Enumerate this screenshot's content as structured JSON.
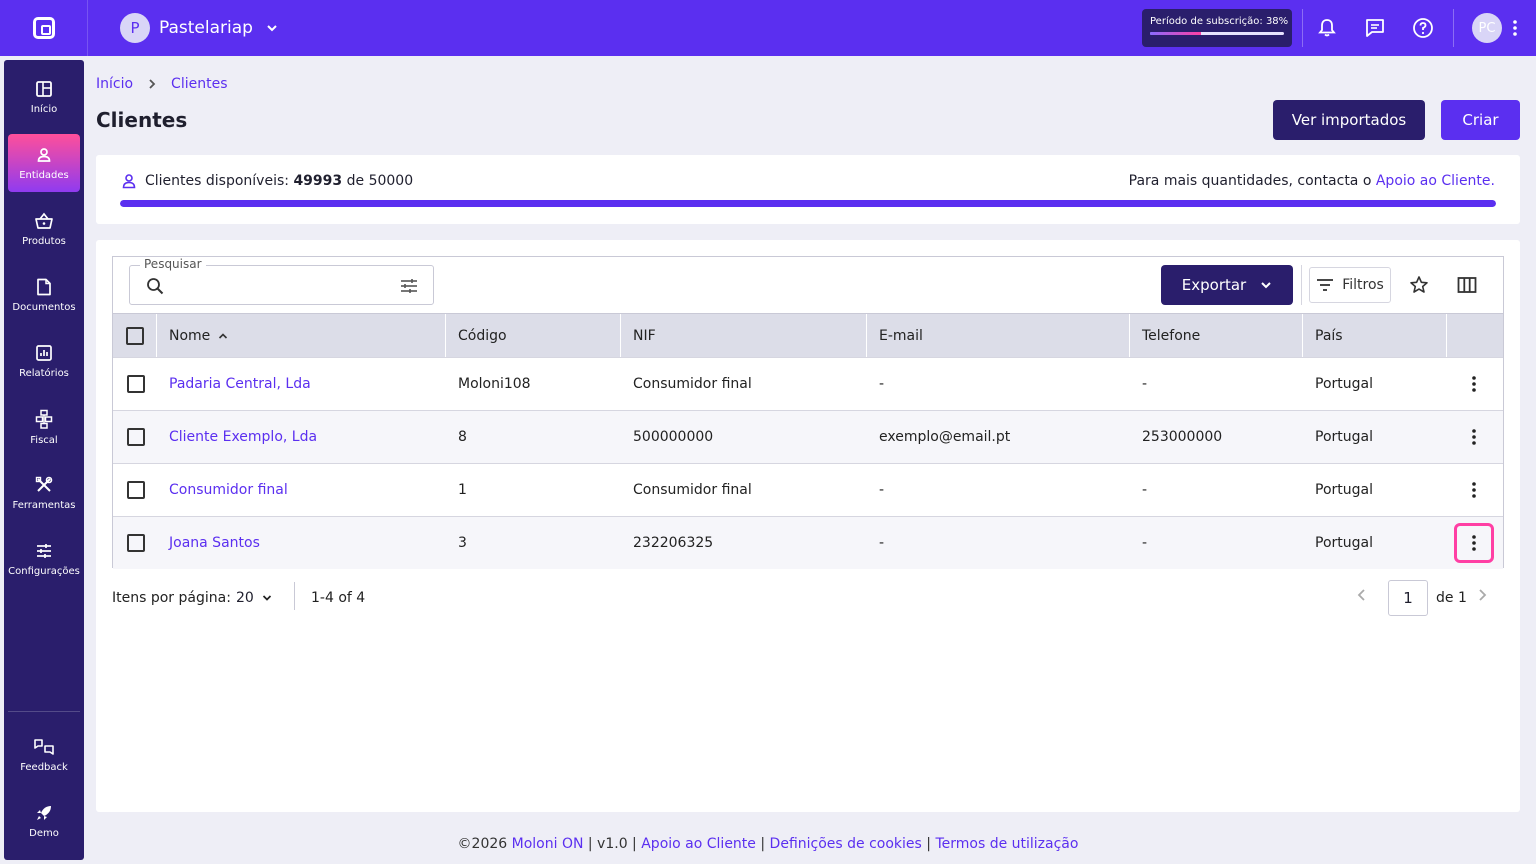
{
  "colors": {
    "primary": "#5b2ff0",
    "dark": "#2a1e6c",
    "accent_pink": "#ff3fa4",
    "background": "#eeeef6"
  },
  "topbar": {
    "company_initial": "P",
    "company_name": "Pastelariap",
    "subscription_label": "Período de subscrição: 38%",
    "subscription_progress": 0.38,
    "user_initials": "PC"
  },
  "sidebar": {
    "items": [
      {
        "label": "Início",
        "icon": "dashboard-icon"
      },
      {
        "label": "Entidades",
        "icon": "user-icon",
        "active": true
      },
      {
        "label": "Produtos",
        "icon": "basket-icon"
      },
      {
        "label": "Documentos",
        "icon": "document-icon"
      },
      {
        "label": "Relatórios",
        "icon": "report-icon"
      },
      {
        "label": "Fiscal",
        "icon": "fiscal-icon"
      },
      {
        "label": "Ferramentas",
        "icon": "tools-icon"
      },
      {
        "label": "Configurações",
        "icon": "settings-sliders-icon"
      }
    ],
    "bottom_items": [
      {
        "label": "Feedback",
        "icon": "feedback-icon"
      },
      {
        "label": "Demo",
        "icon": "rocket-icon"
      }
    ]
  },
  "breadcrumb": {
    "home": "Início",
    "current": "Clientes"
  },
  "page": {
    "title": "Clientes",
    "view_imported_label": "Ver importados",
    "create_label": "Criar"
  },
  "quota": {
    "prefix": "Clientes disponíveis:",
    "available": "49993",
    "of_word": "de",
    "total": "50000",
    "available_fraction": 0.99986,
    "contact_text": "Para mais quantidades, contacta o",
    "contact_link": "Apoio ao Cliente",
    "contact_suffix": "."
  },
  "toolbar": {
    "search_label": "Pesquisar",
    "search_value": "",
    "export_label": "Exportar",
    "filters_label": "Filtros"
  },
  "table": {
    "columns": [
      "Nome",
      "Código",
      "NIF",
      "E-mail",
      "Telefone",
      "País"
    ],
    "sort_column": "Nome",
    "rows": [
      {
        "nome": "Padaria Central, Lda",
        "codigo": "Moloni108",
        "nif": "Consumidor final",
        "email": "-",
        "telefone": "-",
        "pais": "Portugal"
      },
      {
        "nome": "Cliente Exemplo, Lda",
        "codigo": "8",
        "nif": "500000000",
        "email": "exemplo@email.pt",
        "telefone": "253000000",
        "pais": "Portugal"
      },
      {
        "nome": "Consumidor final",
        "codigo": "1",
        "nif": "Consumidor final",
        "email": "-",
        "telefone": "-",
        "pais": "Portugal"
      },
      {
        "nome": "Joana Santos",
        "codigo": "3",
        "nif": "232206325",
        "email": "-",
        "telefone": "-",
        "pais": "Portugal"
      }
    ]
  },
  "pagination": {
    "items_per_page_label": "Itens por página:",
    "items_per_page": "20",
    "range": "1-4 of 4",
    "current_page": "1",
    "of_pages": "de 1"
  },
  "footer": {
    "copyright": "©2026",
    "brand": "Moloni ON",
    "version": "| v1.0 |",
    "support": "Apoio ao Cliente",
    "sep1": "|",
    "cookies": "Definições de cookies",
    "sep2": "|",
    "terms": "Termos de utilização"
  }
}
